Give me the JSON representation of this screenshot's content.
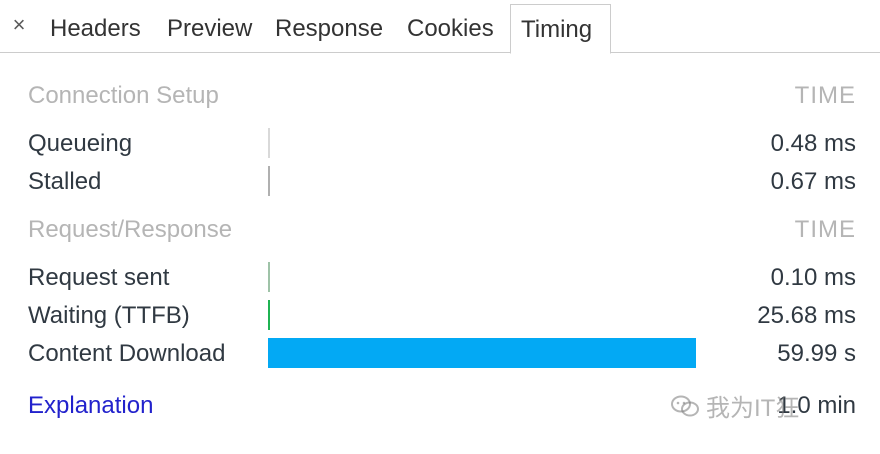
{
  "tabs": {
    "close_symbol": "×",
    "items": [
      "Headers",
      "Preview",
      "Response",
      "Cookies",
      "Timing"
    ],
    "active": "Timing"
  },
  "connection_setup": {
    "heading": "Connection Setup",
    "time_heading": "TIME",
    "rows": [
      {
        "label": "Queueing",
        "value": "0.48 ms",
        "fraction": 0.0,
        "color": "#d9d9d9"
      },
      {
        "label": "Stalled",
        "value": "0.67 ms",
        "fraction": 0.0,
        "color": "#b0b0b0"
      }
    ]
  },
  "request_response": {
    "heading": "Request/Response",
    "time_heading": "TIME",
    "rows": [
      {
        "label": "Request sent",
        "value": "0.10 ms",
        "fraction": 0.0,
        "color": "#9fc3a8"
      },
      {
        "label": "Waiting (TTFB)",
        "value": "25.68 ms",
        "fraction": 0.0,
        "color": "#1fb352"
      },
      {
        "label": "Content Download",
        "value": "59.99 s",
        "fraction": 1.0,
        "color": "#03a9f4"
      }
    ]
  },
  "footer": {
    "explanation_link": "Explanation",
    "total": "1.0 min"
  },
  "watermark": {
    "text": "我为IT狂"
  }
}
